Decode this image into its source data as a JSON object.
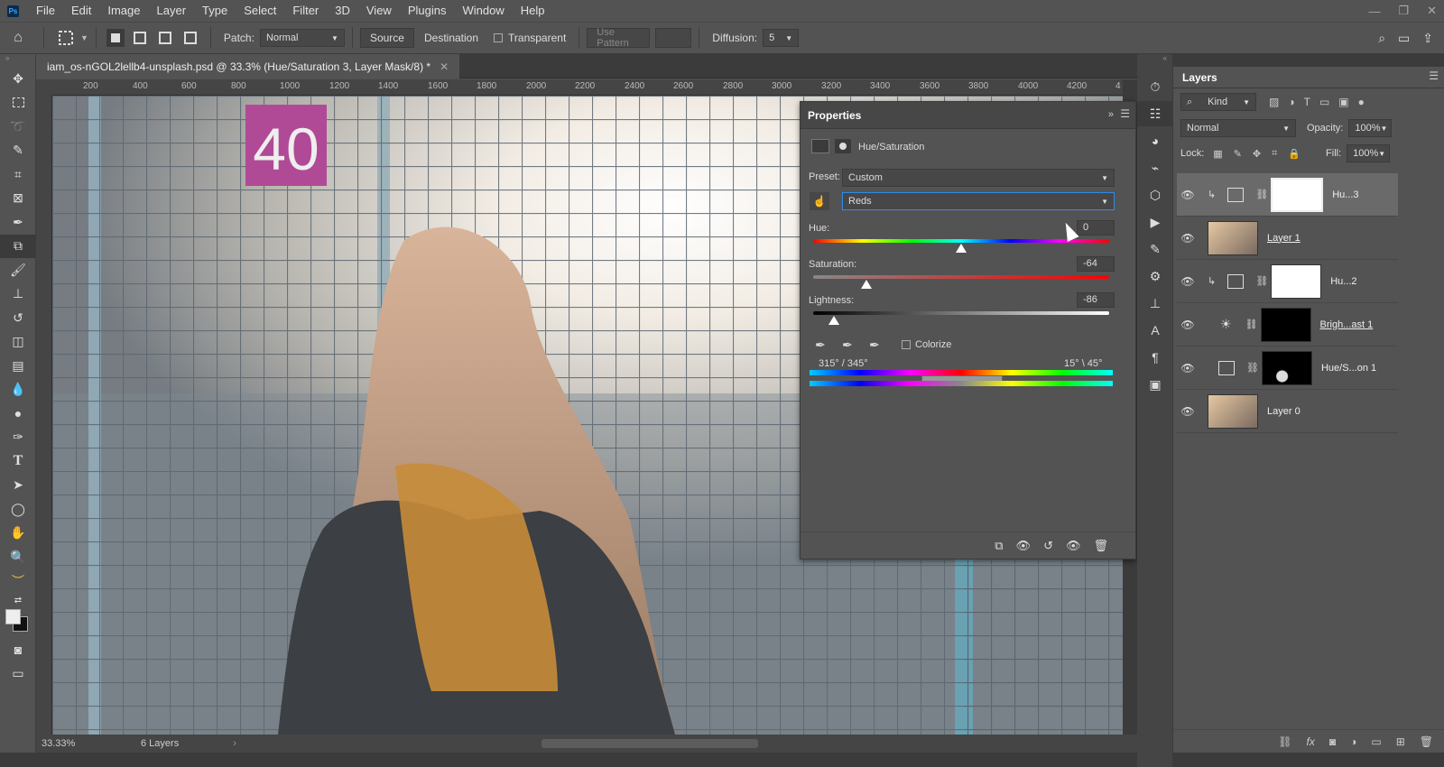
{
  "menubar": {
    "logo": "Ps",
    "items": [
      "File",
      "Edit",
      "Image",
      "Layer",
      "Type",
      "Select",
      "Filter",
      "3D",
      "View",
      "Plugins",
      "Window",
      "Help"
    ]
  },
  "options": {
    "patch_label": "Patch:",
    "patch_mode": "Normal",
    "source_label": "Source",
    "destination_label": "Destination",
    "transparent_label": "Transparent",
    "use_pattern_label": "Use Pattern",
    "diffusion_label": "Diffusion:",
    "diffusion_value": "5"
  },
  "document": {
    "tab_title": "iam_os-nGOL2lellb4-unsplash.psd @ 33.3% (Hue/Saturation 3, Layer Mask/8) *",
    "ruler_ticks": [
      "200",
      "400",
      "600",
      "800",
      "1000",
      "1200",
      "1400",
      "1600",
      "1800",
      "2000",
      "2200",
      "2400",
      "2600",
      "2800",
      "3000",
      "3200",
      "3400",
      "3600",
      "3800",
      "4000",
      "4200",
      "4"
    ],
    "sign_number": "40"
  },
  "status": {
    "zoom": "33.33%",
    "info": "6 Layers"
  },
  "properties": {
    "title": "Properties",
    "adjustment_name": "Hue/Saturation",
    "preset_label": "Preset:",
    "preset_value": "Custom",
    "channel_value": "Reds",
    "hue_label": "Hue:",
    "hue_value": "0",
    "saturation_label": "Saturation:",
    "saturation_value": "-64",
    "lightness_label": "Lightness:",
    "lightness_value": "-86",
    "colorize_label": "Colorize",
    "range_left": "315° / 345°",
    "range_right": "15° \\ 45°"
  },
  "layers_panel": {
    "title": "Layers",
    "filter_kind": "Kind",
    "blend_mode": "Normal",
    "opacity_label": "Opacity:",
    "opacity_value": "100%",
    "lock_label": "Lock:",
    "fill_label": "Fill:",
    "fill_value": "100%",
    "layers": [
      {
        "name": "Hu...3",
        "type": "adjustment",
        "selected": true
      },
      {
        "name": "Layer 1",
        "type": "pixel",
        "selected": false
      },
      {
        "name": "Hu...2",
        "type": "adjustment",
        "selected": false
      },
      {
        "name": "Brigh...ast 1",
        "type": "brightness",
        "selected": false
      },
      {
        "name": "Hue/S...on 1",
        "type": "adjustment",
        "selected": false
      },
      {
        "name": "Layer 0",
        "type": "pixel",
        "selected": false
      }
    ]
  },
  "colors": {
    "ui_bg": "#535353",
    "panel_dark": "#3b3b3b",
    "accent": "#31a8ff"
  }
}
